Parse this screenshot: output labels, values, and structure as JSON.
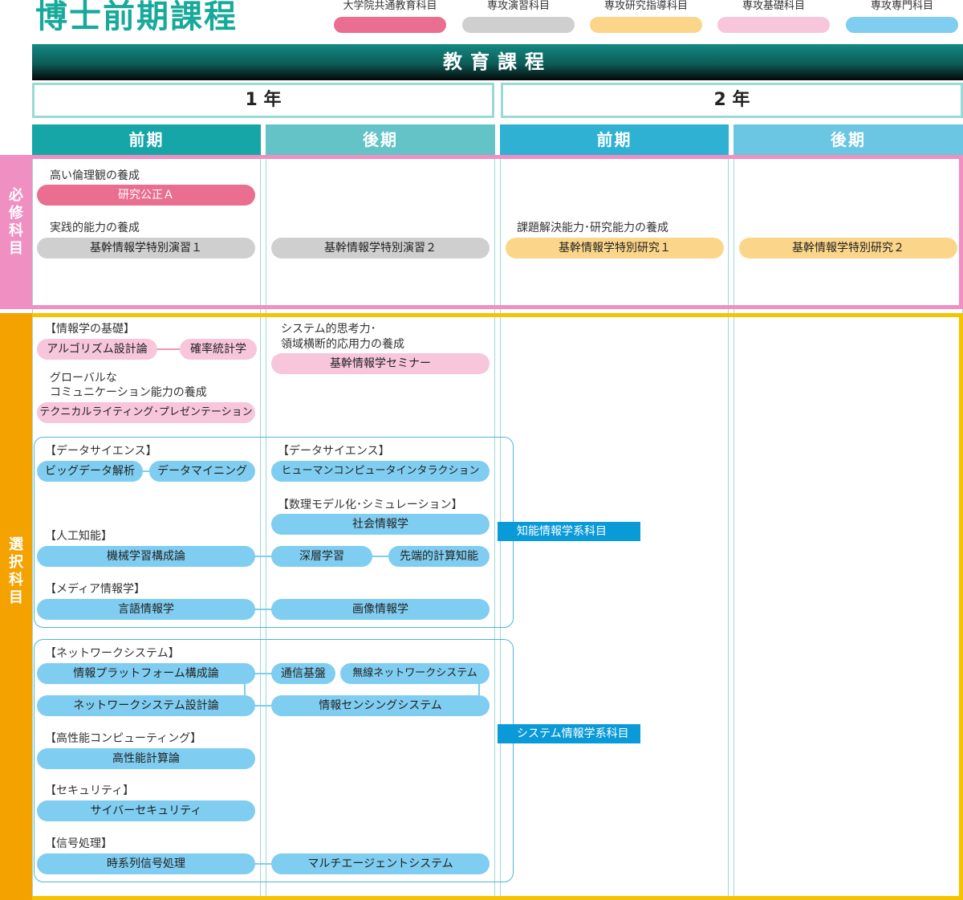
{
  "title": "博士前期課程",
  "legend": [
    {
      "label": "大学院共通教育科目",
      "color": "#e96e90"
    },
    {
      "label": "専攻演習科目",
      "color": "#cfcfcf"
    },
    {
      "label": "専攻研究指導科目",
      "color": "#fbd68a"
    },
    {
      "label": "専攻基礎科目",
      "color": "#f7c6da"
    },
    {
      "label": "専攻専門科目",
      "color": "#7fcdf0"
    }
  ],
  "banner": "教育課程",
  "years": [
    "1 年",
    "2 年"
  ],
  "semesters": [
    "前期",
    "後期",
    "前期",
    "後期"
  ],
  "sections": {
    "required": "必修科目",
    "elective": "選択科目"
  },
  "required": {
    "heading_ethics": "高い倫理観の養成",
    "research_ethics": "研究公正Ａ",
    "heading_practical": "実践的能力の養成",
    "exercise1": "基幹情報学特別演習１",
    "exercise2": "基幹情報学特別演習２",
    "heading_problem": "課題解決能力･研究能力の養成",
    "research1": "基幹情報学特別研究１",
    "research2": "基幹情報学特別研究２"
  },
  "elective": {
    "heading_info_basics": "【情報学の基礎】",
    "algorithm": "アルゴリズム設計論",
    "probability": "確率統計学",
    "heading_global_1": "グローバルな",
    "heading_global_2": "コミュニケーション能力の養成",
    "technical_writing": "テクニカルライティング･プレゼンテーション",
    "heading_system_1": "システム的思考力･",
    "heading_system_2": "領域横断的応用力の養成",
    "seminar": "基幹情報学セミナー",
    "heading_data_science": "【データサイエンス】",
    "big_data": "ビッグデータ解析",
    "data_mining": "データマイニング",
    "heading_data_science_2": "【データサイエンス】",
    "hci": "ヒューマンコンピュータインタラクション",
    "heading_modeling": "【数理モデル化･シミュレーション】",
    "social_info": "社会情報学",
    "heading_ai": "【人工知能】",
    "ml": "機械学習構成論",
    "deep_learning": "深層学習",
    "advanced_computing": "先端的計算知能",
    "heading_media": "【メディア情報学】",
    "language": "言語情報学",
    "image": "画像情報学",
    "intelligent_tag": "知能情報学系科目",
    "heading_network": "【ネットワークシステム】",
    "platform": "情報プラットフォーム構成論",
    "comm_base": "通信基盤",
    "wireless": "無線ネットワークシステム",
    "network_design": "ネットワークシステム設計論",
    "sensing": "情報センシングシステム",
    "heading_hpc": "【高性能コンピューティング】",
    "hpc": "高性能計算論",
    "heading_security": "【セキュリティ】",
    "cyber": "サイバーセキュリティ",
    "heading_signal": "【信号処理】",
    "time_series": "時系列信号処理",
    "multi_agent": "マルチエージェントシステム",
    "system_tag": "システム情報学系科目"
  }
}
